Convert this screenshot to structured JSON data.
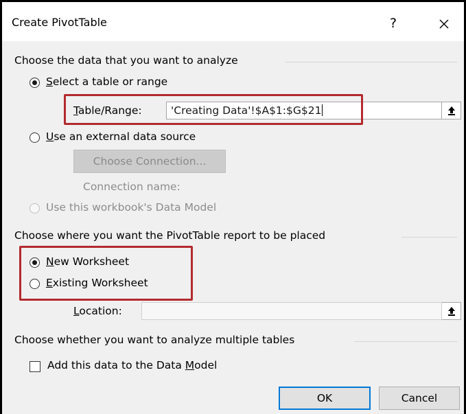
{
  "dialog": {
    "title": "Create PivotTable",
    "help_glyph": "?",
    "close_glyph": "✕"
  },
  "analyze_section": {
    "heading": "Choose the data that you want to analyze",
    "option_table": {
      "prefix": "",
      "accel": "S",
      "rest": "elect a table or range",
      "selected": true
    },
    "table_range": {
      "accel": "T",
      "rest": "able/Range:",
      "value": "'Creating Data'!$A$1:$G$21"
    },
    "option_external": {
      "accel": "U",
      "rest": "se an external data source",
      "selected": false
    },
    "choose_connection": "Choose Connection...",
    "connection_name_label": "Connection name:",
    "option_data_model": {
      "label": "Use this workbook's Data Model",
      "selected": false,
      "enabled": false
    }
  },
  "placement_section": {
    "heading": "Choose where you want the PivotTable report to be placed",
    "option_new": {
      "accel": "N",
      "rest": "ew Worksheet",
      "selected": true
    },
    "option_existing": {
      "accel": "E",
      "rest": "xisting Worksheet",
      "selected": false
    },
    "location": {
      "accel": "L",
      "rest": "ocation:",
      "value": ""
    }
  },
  "multiple_section": {
    "heading": "Choose whether you want to analyze multiple tables",
    "checkbox": {
      "pre": "Add this data to the Data ",
      "accel": "M",
      "post": "odel",
      "checked": false
    }
  },
  "buttons": {
    "ok": "OK",
    "cancel": "Cancel"
  },
  "icons": {
    "picker_glyph": "⭱"
  },
  "colors": {
    "highlight": "#b32a2e",
    "default_button_border": "#0078d7",
    "dialog_background": "#f0f0f0"
  }
}
